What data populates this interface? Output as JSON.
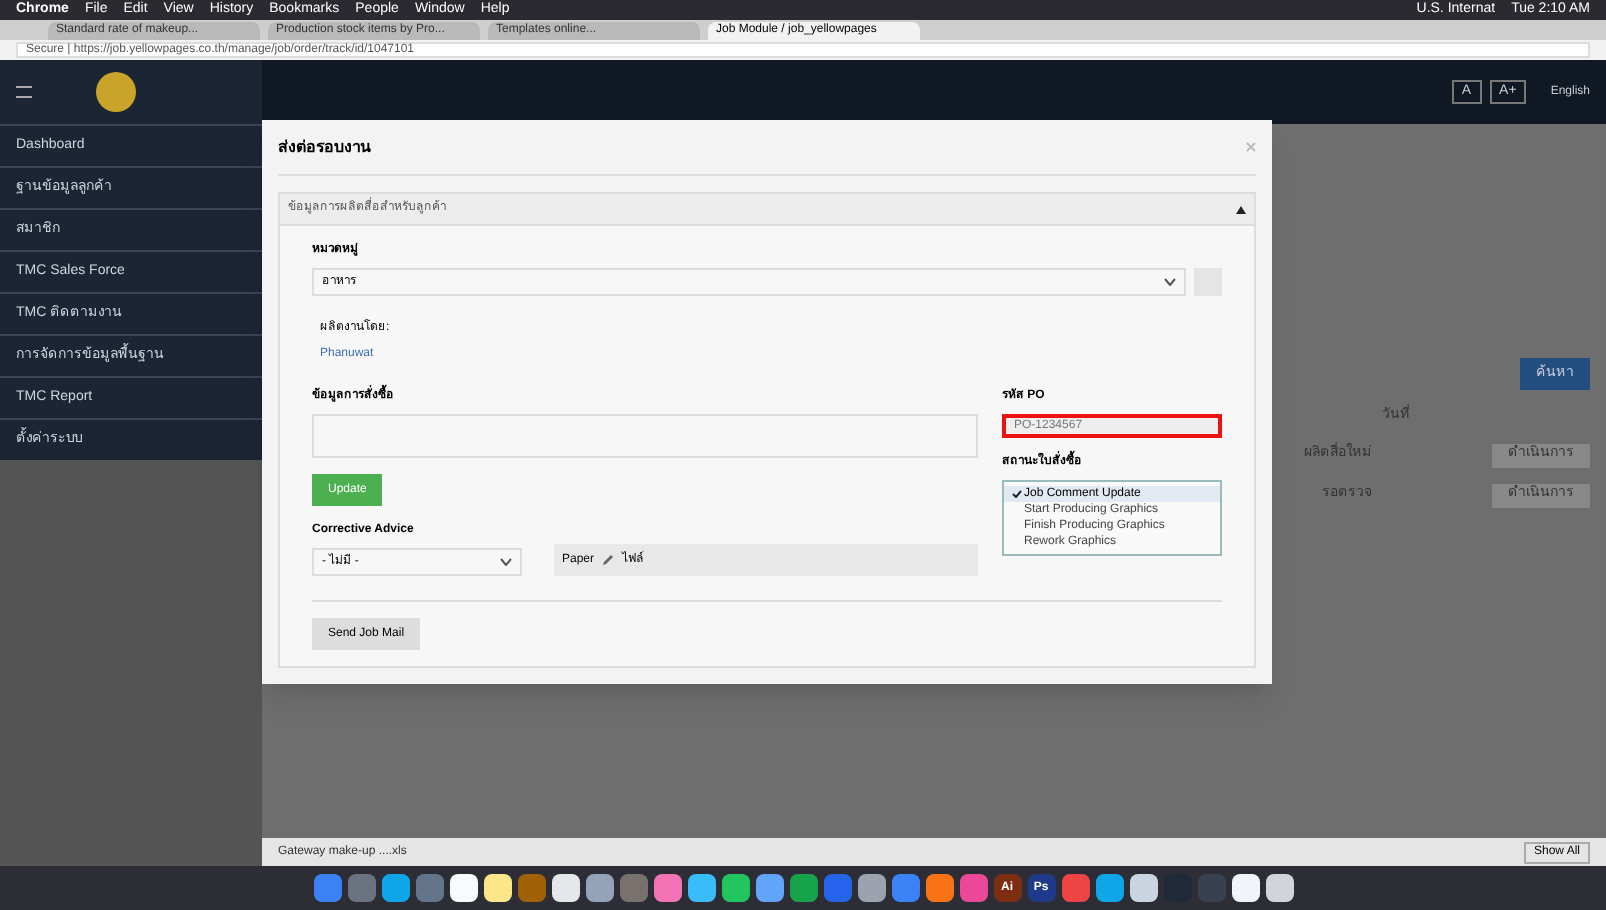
{
  "menu_bar": {
    "items": [
      "Chrome",
      "File",
      "Edit",
      "View",
      "History",
      "Bookmarks",
      "People",
      "Window",
      "Help"
    ],
    "status": [
      "U.S. Internat",
      "Tue 2:10 AM"
    ]
  },
  "browser_tabs": [
    {
      "label": "Standard rate of makeup...",
      "selected": false
    },
    {
      "label": "Production stock items by Pro...",
      "selected": false
    },
    {
      "label": "Templates online...",
      "selected": false
    },
    {
      "label": "Job Module / job_yellowpages",
      "selected": true
    }
  ],
  "address": "Secure | https://job.yellowpages.co.th/manage/job/order/track/id/1047101",
  "header": {
    "buttons": [
      "A",
      "A+"
    ],
    "language": "English"
  },
  "sidebar": {
    "items": [
      "Dashboard",
      "ฐานข้อมูลลูกค้า",
      "สมาชิก",
      "TMC Sales Force",
      "TMC ติดตามงาน",
      "การจัดการข้อมูลพื้นฐาน",
      "TMC Report",
      "ตั้งค่าระบบ"
    ]
  },
  "background": {
    "search_button": "ค้นหา",
    "column_header": "วันที่",
    "rows": [
      {
        "date": "ผลิตสื่อใหม่",
        "action": "ดำเนินการ"
      },
      {
        "date": "รอตรวจ",
        "action": "ดำเนินการ"
      }
    ]
  },
  "modal": {
    "title": "ส่งต่อรอบงาน",
    "section_title": "ข้อมูลการผลิตสื่อสำหรับลูกค้า",
    "section_expanded": true,
    "category_label": "หมวดหมู่",
    "category_value": "อาหาร",
    "producer_label": "ผลิตงานโดย:",
    "producer_link": "Phanuwat",
    "order_label": "ข้อมูลการสั่งซื้อ",
    "update_button": "Update",
    "advice_label": "Corrective Advice",
    "advice_value": "- ไม่มี -",
    "file_label": "Paper",
    "file_value": "ไฟล์",
    "send_button": "Send Job Mail",
    "po_label": "รหัส PO",
    "po_value": "PO-1234567",
    "status_label": "สถานะใบสั่งซื้อ",
    "status_options": [
      {
        "label": "Job Comment Update",
        "selected": true
      },
      {
        "label": "Start Producing Graphics",
        "selected": false
      },
      {
        "label": "Finish Producing Graphics",
        "selected": false
      },
      {
        "label": "Rework Graphics",
        "selected": false
      }
    ]
  },
  "download_bar": {
    "file": "Gateway make-up ....xls",
    "show_all": "Show All"
  },
  "dock": [
    {
      "color": "#3b82f6"
    },
    {
      "color": "#6b7280"
    },
    {
      "color": "#0ea5e9"
    },
    {
      "color": "#64748b"
    },
    {
      "color": "#f8fafc"
    },
    {
      "color": "#fde68a"
    },
    {
      "color": "#a16207"
    },
    {
      "color": "#e5e7eb"
    },
    {
      "color": "#94a3b8"
    },
    {
      "color": "#78716c"
    },
    {
      "color": "#f472b6"
    },
    {
      "color": "#38bdf8"
    },
    {
      "color": "#22c55e"
    },
    {
      "color": "#60a5fa"
    },
    {
      "color": "#16a34a"
    },
    {
      "color": "#2563eb"
    },
    {
      "color": "#9ca3af"
    },
    {
      "color": "#3b82f6"
    },
    {
      "color": "#f97316"
    },
    {
      "color": "#ec4899"
    },
    {
      "color": "#7c2d12",
      "label": "Ai"
    },
    {
      "color": "#1e3a8a",
      "label": "Ps"
    },
    {
      "color": "#ef4444"
    },
    {
      "color": "#0ea5e9"
    },
    {
      "color": "#cbd5e1"
    },
    {
      "color": "#1f2937"
    },
    {
      "color": "#374151"
    },
    {
      "color": "#f1f5f9"
    },
    {
      "color": "#d1d5db"
    }
  ]
}
